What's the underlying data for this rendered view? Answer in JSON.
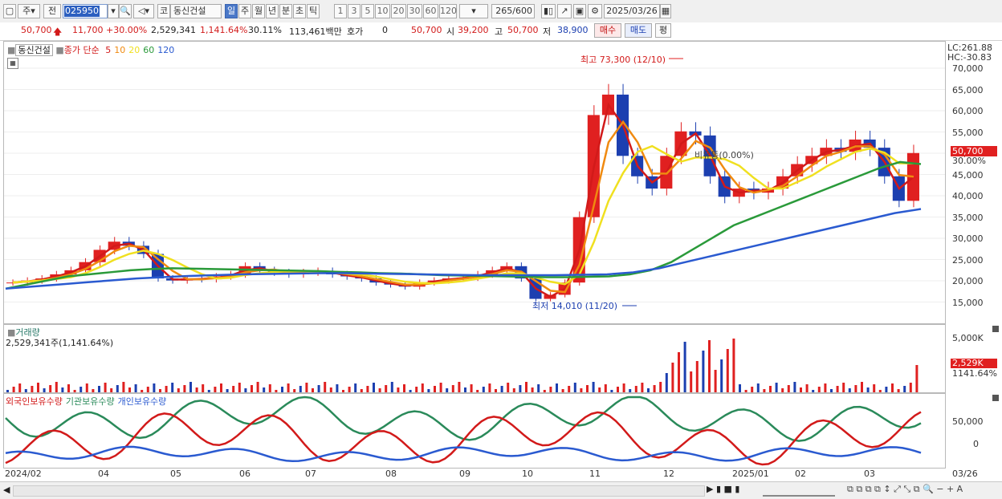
{
  "toolbar": {
    "period_label": "주",
    "prev_label": "전",
    "stock_code": "025950",
    "market_label": "코",
    "stock_name": "동신건설",
    "period_tabs": [
      "일",
      "주",
      "월",
      "년",
      "분",
      "초",
      "틱"
    ],
    "active_tab": "일",
    "intervals": [
      "1",
      "3",
      "5",
      "10",
      "20",
      "30",
      "60",
      "120"
    ],
    "count_display": "265",
    "count_total": "/600",
    "date": "2025/03/26"
  },
  "quote": {
    "price": "50,700",
    "change": "11,700",
    "change_pct": "+30.00%",
    "volume": "2,529,341",
    "volume_ratio": "1,141.64%",
    "turnover": "30.11%",
    "amount": "113,461백만",
    "hoga_label": "호가",
    "hoga_value": "0",
    "ask": "50,700",
    "open_label": "시",
    "open": "39,200",
    "high_label": "고",
    "high": "50,700",
    "low_label": "저",
    "low": "38,900",
    "buy_label": "매수",
    "sell_label": "매도",
    "eval_label": "평"
  },
  "price_panel": {
    "title": "동신건설",
    "ma_label": "종가 단순",
    "ma_periods": [
      "5",
      "10",
      "20",
      "60",
      "120"
    ],
    "ma_colors": [
      "#d21a1a",
      "#f08a10",
      "#f0e020",
      "#2a9a3a",
      "#2a5ad0"
    ],
    "lc_label": "LC:261.88",
    "hc_label": "HC:-30.83",
    "high_annotation": "최고 73,300 (12/10)",
    "low_annotation": "최저 14,010 (11/20)",
    "event_label": "비유통(0.00%)",
    "last_price_tag": "50,700",
    "last_pct_tag": "30.00%",
    "y_ticks": [
      "70,000",
      "65,000",
      "60,000",
      "55,000",
      "50,000",
      "45,000",
      "40,000",
      "35,000",
      "30,000",
      "25,000",
      "20,000",
      "15,000"
    ]
  },
  "volume_panel": {
    "title": "거래량",
    "subtitle": "2,529,341주(1,141.64%)",
    "y_tick": "5,000K",
    "last_tag": "2,529K",
    "last_pct": "1141.64%"
  },
  "holding_panel": {
    "series_labels": [
      "외국인보유수량",
      "기관보유수량",
      "개인보유수량"
    ],
    "series_colors": [
      "#d21a1a",
      "#2a8a5a",
      "#2a5ad0"
    ],
    "y_ticks": [
      "50,000",
      "0"
    ]
  },
  "x_axis": {
    "labels": [
      "2024/02",
      "04",
      "05",
      "06",
      "07",
      "08",
      "09",
      "10",
      "11",
      "12",
      "2025/01",
      "02",
      "03"
    ],
    "end_label": "03/26"
  },
  "chart_data": {
    "type": "candlestick",
    "x_start": "2024/02",
    "x_end": "2025/03/26",
    "closes": [
      19000,
      19500,
      20000,
      21000,
      22000,
      24000,
      27000,
      29000,
      28000,
      26000,
      20000,
      19500,
      20000,
      19800,
      20500,
      21000,
      23000,
      22000,
      21500,
      21000,
      21500,
      21800,
      21000,
      20500,
      20000,
      19000,
      18500,
      18000,
      19000,
      19500,
      20000,
      20200,
      21000,
      22000,
      23000,
      20000,
      15000,
      16000,
      19000,
      35000,
      60000,
      65000,
      50000,
      45000,
      42000,
      50000,
      56000,
      55000,
      45000,
      40000,
      42000,
      41000,
      42000,
      45000,
      48000,
      50000,
      52000,
      51000,
      54000,
      52000,
      45000,
      39000,
      50700
    ],
    "ma_series": [
      {
        "name": "5",
        "color": "#d21a1a"
      },
      {
        "name": "10",
        "color": "#f08a10"
      },
      {
        "name": "20",
        "color": "#f0e020"
      },
      {
        "name": "60",
        "color": "#2a9a3a"
      },
      {
        "name": "120",
        "color": "#2a5ad0"
      }
    ],
    "ma60": [
      17500,
      18500,
      19500,
      20500,
      21000,
      21500,
      22000,
      22300,
      22500,
      22400,
      22300,
      22200,
      22100,
      22000,
      21900,
      21800,
      21600,
      21500,
      21300,
      21200,
      21000,
      20800,
      20700,
      20600,
      20500,
      20400,
      20300,
      20300,
      20400,
      20500,
      21000,
      22000,
      24000,
      27000,
      30000,
      33000,
      35000,
      37000,
      39000,
      41000,
      43000,
      45000,
      47000,
      48500,
      48000
    ],
    "ma120": [
      17500,
      18000,
      18500,
      19000,
      19500,
      20000,
      20300,
      20600,
      20800,
      21000,
      21100,
      21200,
      21300,
      21300,
      21200,
      21100,
      21000,
      20900,
      20800,
      20800,
      20800,
      20800,
      20900,
      21000,
      21500,
      22500,
      24000,
      25500,
      27000,
      28500,
      30000,
      31500,
      33000,
      34500,
      36000,
      37000
    ],
    "y_range": [
      10000,
      75000
    ],
    "high": {
      "value": 73300,
      "date": "12/10"
    },
    "low": {
      "value": 14010,
      "date": "11/20"
    }
  }
}
